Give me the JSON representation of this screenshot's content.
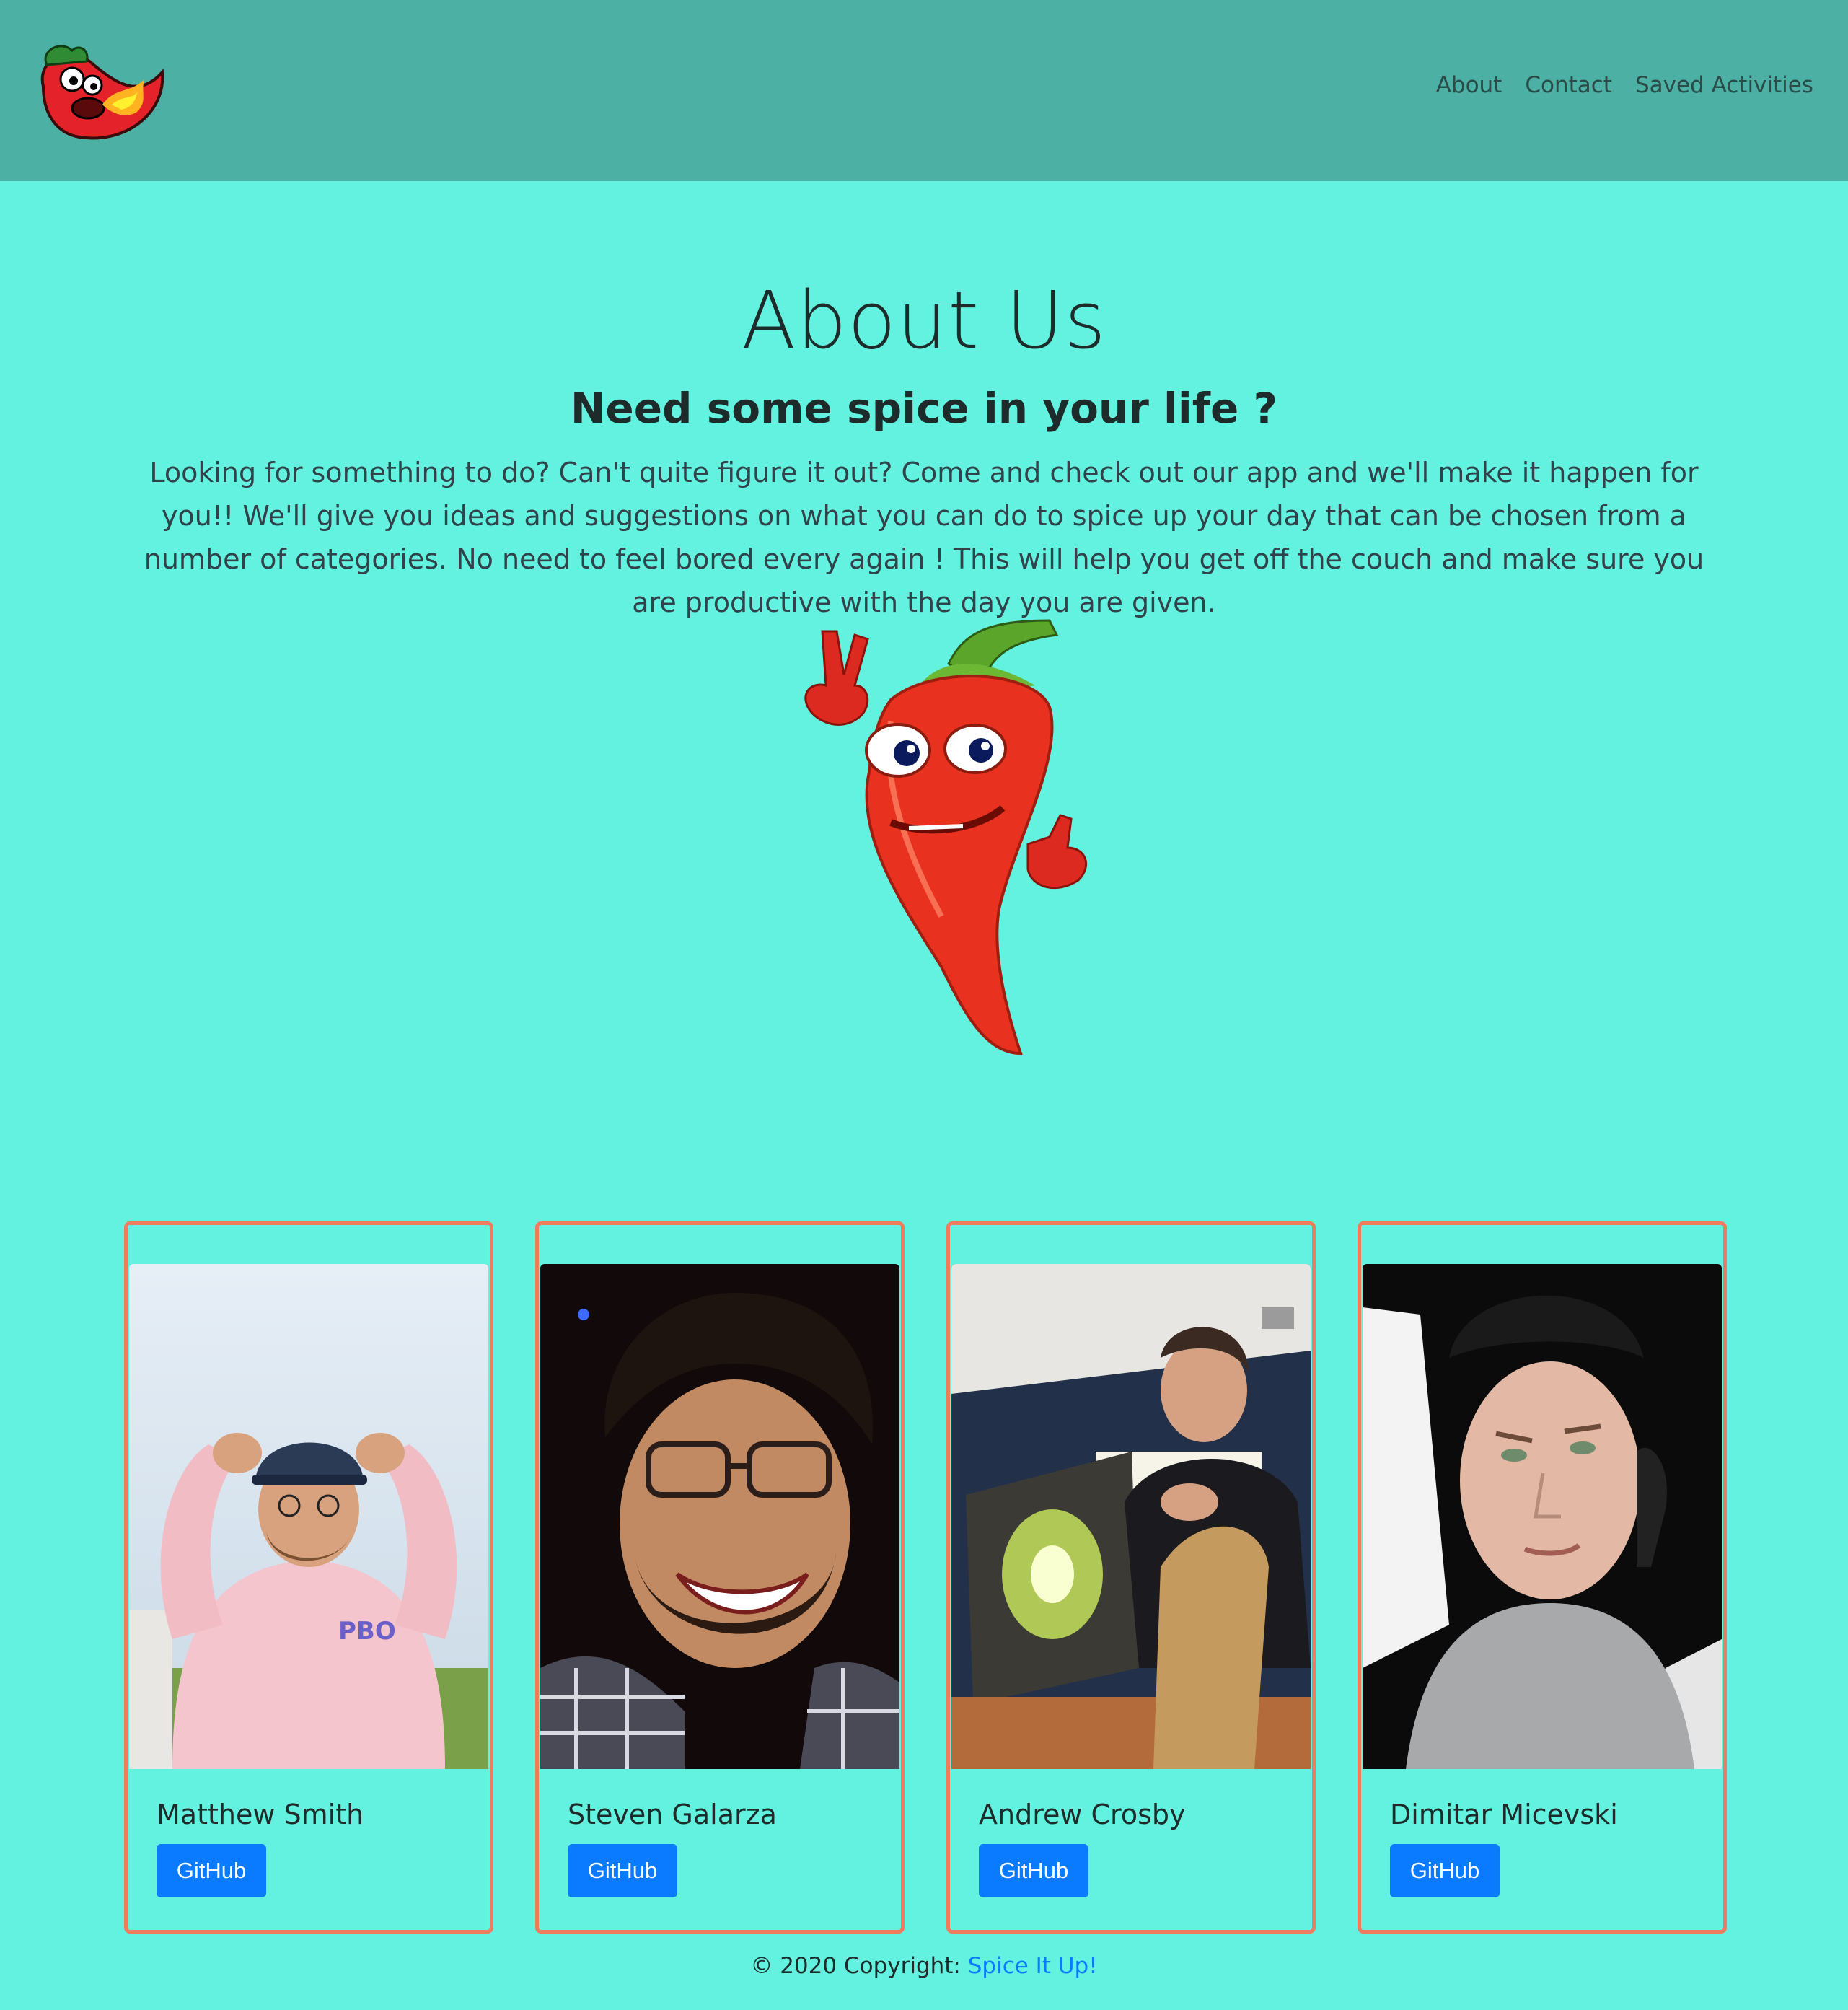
{
  "nav": {
    "links": [
      "About",
      "Contact",
      "Saved Activities"
    ]
  },
  "hero": {
    "title": "About Us",
    "tagline": "Need some spice in your life ?",
    "intro": "Looking for something to do? Can't quite figure it out? Come and check out our app and we'll make it happen for you!! We'll give you ideas and suggestions on what you can do to spice up your day that can be chosen from a number of categories. No need to feel bored every again ! This will help you get off the couch and make sure you are productive with the day you are given."
  },
  "team": [
    {
      "name": "Matthew Smith",
      "button": "GitHub"
    },
    {
      "name": "Steven Galarza",
      "button": "GitHub"
    },
    {
      "name": "Andrew Crosby",
      "button": "GitHub"
    },
    {
      "name": "Dimitar Micevski",
      "button": "GitHub"
    }
  ],
  "footer": {
    "prefix": "© 2020 Copyright: ",
    "link": "Spice It Up!"
  },
  "colors": {
    "background": "#62f2df",
    "navbar": "#4cb1a4",
    "card_border": "#ef7c5c",
    "button": "#0a7bff"
  }
}
